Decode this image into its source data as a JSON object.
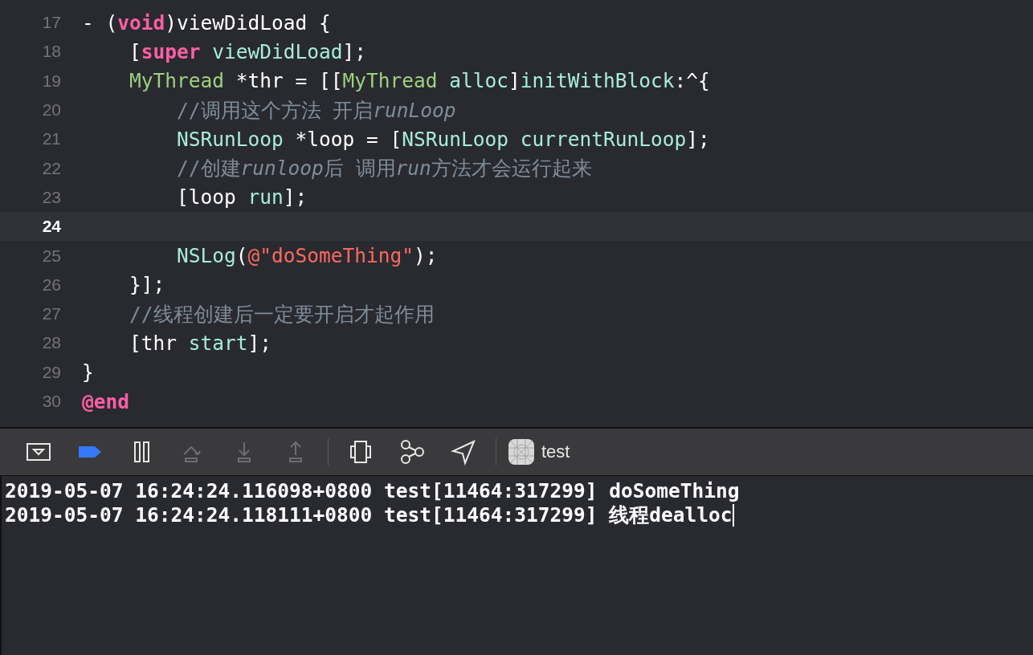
{
  "editor": {
    "lines": [
      {
        "number": "17",
        "current": false,
        "tokens": [
          {
            "kind": "plain",
            "text": "- ("
          },
          {
            "kind": "keyword",
            "text": "void"
          },
          {
            "kind": "plain",
            "text": ")viewDidLoad {"
          }
        ]
      },
      {
        "number": "18",
        "current": false,
        "tokens": [
          {
            "kind": "plain",
            "text": "    ["
          },
          {
            "kind": "keyword",
            "text": "super "
          },
          {
            "kind": "method",
            "text": "viewDidLoad"
          },
          {
            "kind": "plain",
            "text": "];"
          }
        ]
      },
      {
        "number": "19",
        "current": false,
        "tokens": [
          {
            "kind": "type",
            "text": "    MyThread"
          },
          {
            "kind": "plain",
            "text": " *thr = [["
          },
          {
            "kind": "type",
            "text": "MyThread "
          },
          {
            "kind": "method",
            "text": "alloc"
          },
          {
            "kind": "plain",
            "text": "]"
          },
          {
            "kind": "method",
            "text": "initWithBlock"
          },
          {
            "kind": "plain",
            "text": ":^{"
          }
        ]
      },
      {
        "number": "20",
        "current": false,
        "tokens": [
          {
            "kind": "comment",
            "text": "        //调用这个方法 开启"
          },
          {
            "kind": "comment-em",
            "text": "runLoop"
          }
        ]
      },
      {
        "number": "21",
        "current": false,
        "tokens": [
          {
            "kind": "method",
            "text": "        NSRunLoop"
          },
          {
            "kind": "plain",
            "text": " *loop = ["
          },
          {
            "kind": "method",
            "text": "NSRunLoop currentRunLoop"
          },
          {
            "kind": "plain",
            "text": "];"
          }
        ]
      },
      {
        "number": "22",
        "current": false,
        "tokens": [
          {
            "kind": "comment",
            "text": "        //创建"
          },
          {
            "kind": "comment-em",
            "text": "runloop"
          },
          {
            "kind": "comment",
            "text": "后 调用"
          },
          {
            "kind": "comment-em",
            "text": "run"
          },
          {
            "kind": "comment",
            "text": "方法才会运行起来"
          }
        ]
      },
      {
        "number": "23",
        "current": false,
        "tokens": [
          {
            "kind": "plain",
            "text": "        [loop "
          },
          {
            "kind": "method",
            "text": "run"
          },
          {
            "kind": "plain",
            "text": "];"
          }
        ]
      },
      {
        "number": "24",
        "current": true
      },
      {
        "number": "25",
        "current": false,
        "tokens": [
          {
            "kind": "method",
            "text": "        NSLog"
          },
          {
            "kind": "plain",
            "text": "("
          },
          {
            "kind": "string",
            "text": "@\"doSomeThing\""
          },
          {
            "kind": "plain",
            "text": ");"
          }
        ]
      },
      {
        "number": "26",
        "current": false,
        "tokens": [
          {
            "kind": "plain",
            "text": "    }];"
          }
        ]
      },
      {
        "number": "27",
        "current": false,
        "tokens": [
          {
            "kind": "comment",
            "text": "    //线程创建后一定要开启才起作用"
          }
        ]
      },
      {
        "number": "28",
        "current": false,
        "tokens": [
          {
            "kind": "plain",
            "text": "    [thr "
          },
          {
            "kind": "method",
            "text": "start"
          },
          {
            "kind": "plain",
            "text": "];"
          }
        ]
      },
      {
        "number": "29",
        "current": false,
        "tokens": [
          {
            "kind": "plain",
            "text": "}"
          }
        ]
      },
      {
        "number": "30",
        "current": false,
        "tokens": [
          {
            "kind": "keyword",
            "text": "@end"
          }
        ]
      }
    ]
  },
  "debug_bar": {
    "buttons": [
      {
        "kind": "hide",
        "disabled": false
      },
      {
        "kind": "breakpoints",
        "disabled": false,
        "active": true
      },
      {
        "kind": "pause",
        "disabled": false
      },
      {
        "kind": "step-over",
        "disabled": true
      },
      {
        "kind": "step-in",
        "disabled": true
      },
      {
        "kind": "step-out",
        "disabled": true
      },
      {
        "kind": "separator"
      },
      {
        "kind": "view-debugger",
        "disabled": false
      },
      {
        "kind": "memory-graph",
        "disabled": false
      },
      {
        "kind": "location",
        "disabled": false
      },
      {
        "kind": "separator"
      }
    ],
    "target": {
      "label": "test"
    }
  },
  "console": {
    "lines": [
      "2019-05-07 16:24:24.116098+0800 test[11464:317299] doSomeThing",
      "2019-05-07 16:24:24.118111+0800 test[11464:317299] 线程dealloc"
    ],
    "cursor": true
  }
}
